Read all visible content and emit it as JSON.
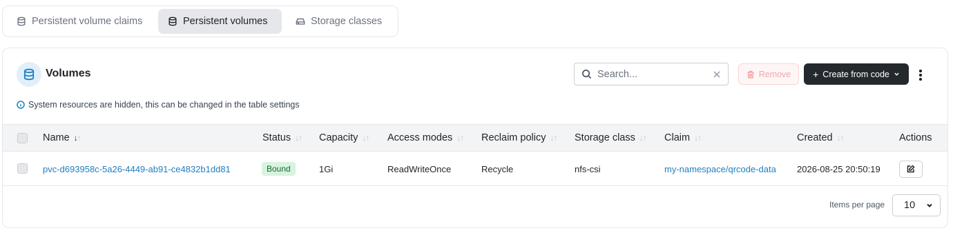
{
  "tabs": [
    {
      "label": "Persistent volume claims",
      "icon": "database-icon",
      "active": false
    },
    {
      "label": "Persistent volumes",
      "icon": "database-icon",
      "active": true
    },
    {
      "label": "Storage classes",
      "icon": "hard-drive-icon",
      "active": false
    }
  ],
  "card": {
    "title": "Volumes",
    "title_icon": "database-icon",
    "search_placeholder": "Search...",
    "remove_label": "Remove",
    "create_label": "Create from code",
    "notice": "System resources are hidden, this can be changed in the table settings"
  },
  "table": {
    "columns": [
      "Name",
      "Status",
      "Capacity",
      "Access modes",
      "Reclaim policy",
      "Storage class",
      "Claim",
      "Created",
      "Actions"
    ],
    "rows": [
      {
        "name": "pvc-d693958c-5a26-4449-ab91-ce4832b1dd81",
        "status": "Bound",
        "capacity": "1Gi",
        "access_modes": "ReadWriteOnce",
        "reclaim_policy": "Recycle",
        "storage_class": "nfs-csi",
        "claim": "my-namespace/qrcode-data",
        "created": "2026-08-25 20:50:19"
      }
    ]
  },
  "pagination": {
    "items_per_page_label": "Items per page",
    "items_per_page": "10"
  },
  "colors": {
    "accent": "#1e7fc0",
    "primary_button": "#24292e",
    "status_bound_bg": "#d8f3df",
    "status_bound_text": "#146c2e"
  }
}
